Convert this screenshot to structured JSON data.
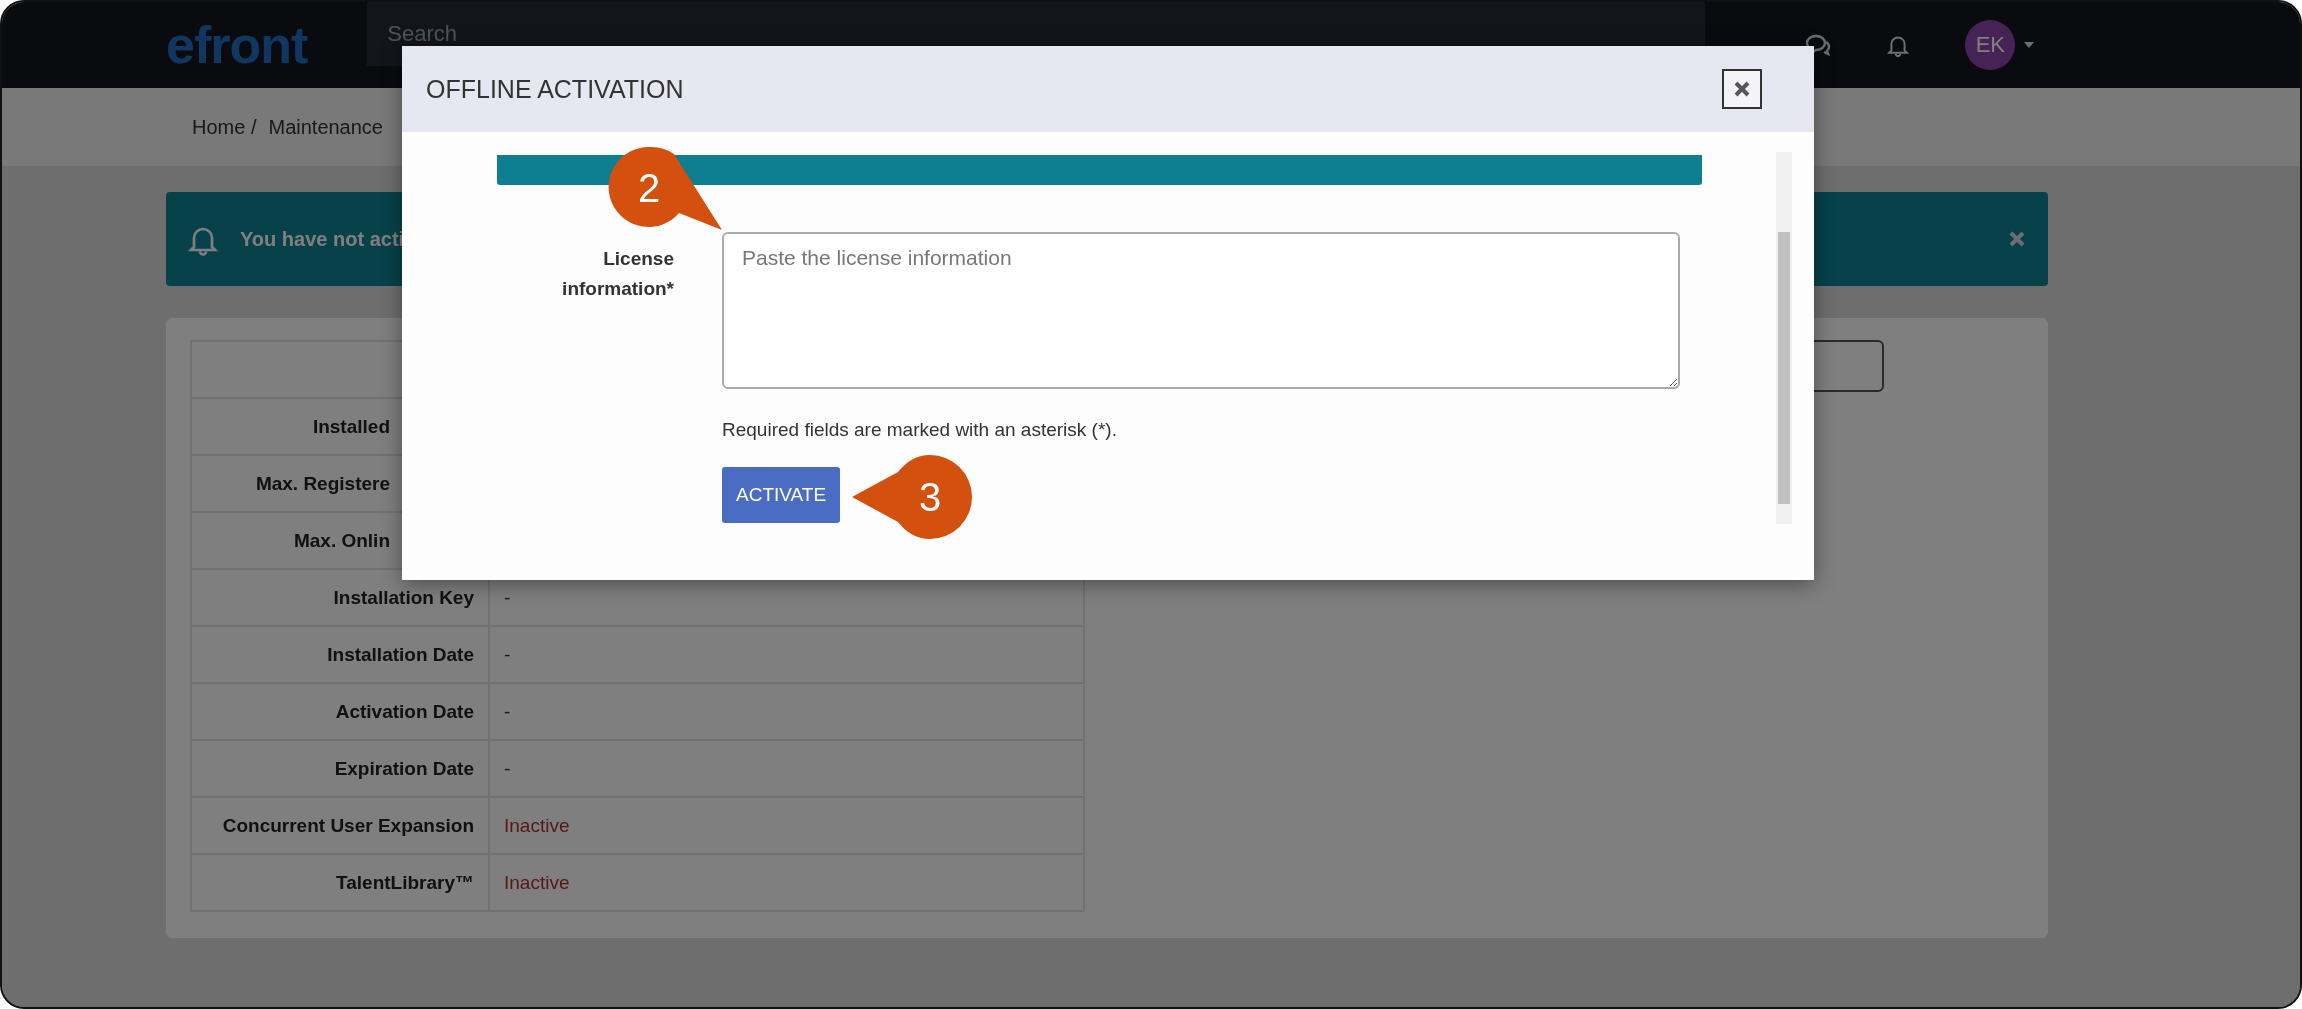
{
  "navbar": {
    "logo": "efront",
    "search": {
      "placeholder": "Search"
    },
    "avatar": "EK"
  },
  "breadcrumb": [
    "Home /",
    "Maintenance"
  ],
  "alert": {
    "text": "You have not acti"
  },
  "license_table": {
    "rows": [
      {
        "label": "Installed"
      },
      {
        "label": "Max. Registere"
      },
      {
        "label": "Max. Onlin"
      },
      {
        "label": "Installation Key",
        "value": "-",
        "kind": "text"
      },
      {
        "label": "Installation Date",
        "value": "-",
        "kind": "text"
      },
      {
        "label": "Activation Date",
        "value": "-",
        "kind": "text"
      },
      {
        "label": "Expiration Date",
        "value": "-",
        "kind": "text"
      },
      {
        "label": "Concurrent User Expansion",
        "value": "Inactive",
        "kind": "status"
      },
      {
        "label": "TalentLibrary™",
        "value": "Inactive",
        "kind": "status"
      }
    ]
  },
  "modal": {
    "title": "OFFLINE ACTIVATION",
    "field": {
      "label": "License information*",
      "placeholder": "Paste the license information"
    },
    "hint": "Required fields are marked with an asterisk (*).",
    "button": "ACTIVATE"
  },
  "callouts": [
    {
      "label": "2",
      "kind": "up-right"
    },
    {
      "label": "3",
      "kind": "left"
    }
  ]
}
